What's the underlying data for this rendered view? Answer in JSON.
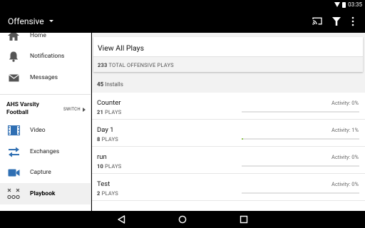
{
  "status_bar": {
    "time": "03:35"
  },
  "app_bar": {
    "title": "Offensive"
  },
  "drawer": {
    "top_items": [
      {
        "label": "Home",
        "icon": "home-icon"
      },
      {
        "label": "Notifications",
        "icon": "bell-icon"
      },
      {
        "label": "Messages",
        "icon": "envelope-icon"
      }
    ],
    "team": {
      "name": "AHS Varsity Football",
      "switch_label": "SWITCH"
    },
    "team_items": [
      {
        "label": "Video",
        "icon": "film-icon"
      },
      {
        "label": "Exchanges",
        "icon": "swap-arrows-icon"
      },
      {
        "label": "Capture",
        "icon": "video-camera-icon"
      },
      {
        "label": "Playbook",
        "icon": "playbook-xo-icon",
        "active": true
      }
    ]
  },
  "content": {
    "view_all_label": "View All Plays",
    "total_count": "233",
    "total_label": "TOTAL OFFENSIVE PLAYS",
    "installs_count": "45",
    "installs_label": "Installs",
    "plays": [
      {
        "name": "Counter",
        "count": "21",
        "unit": "PLAYS",
        "activity": "Activity: 0%",
        "activity_value": 0
      },
      {
        "name": "Day 1",
        "count": "8",
        "unit": "PLAYS",
        "activity": "Activity: 1%",
        "activity_value": 1
      },
      {
        "name": "run",
        "count": "10",
        "unit": "PLAYS",
        "activity": "Activity: 0%",
        "activity_value": 0
      },
      {
        "name": "Test",
        "count": "2",
        "unit": "PLAYS",
        "activity": "Activity: 0%",
        "activity_value": 0
      }
    ]
  },
  "colors": {
    "activity_fill": "#8bc34a",
    "app_bar": "#000000"
  }
}
